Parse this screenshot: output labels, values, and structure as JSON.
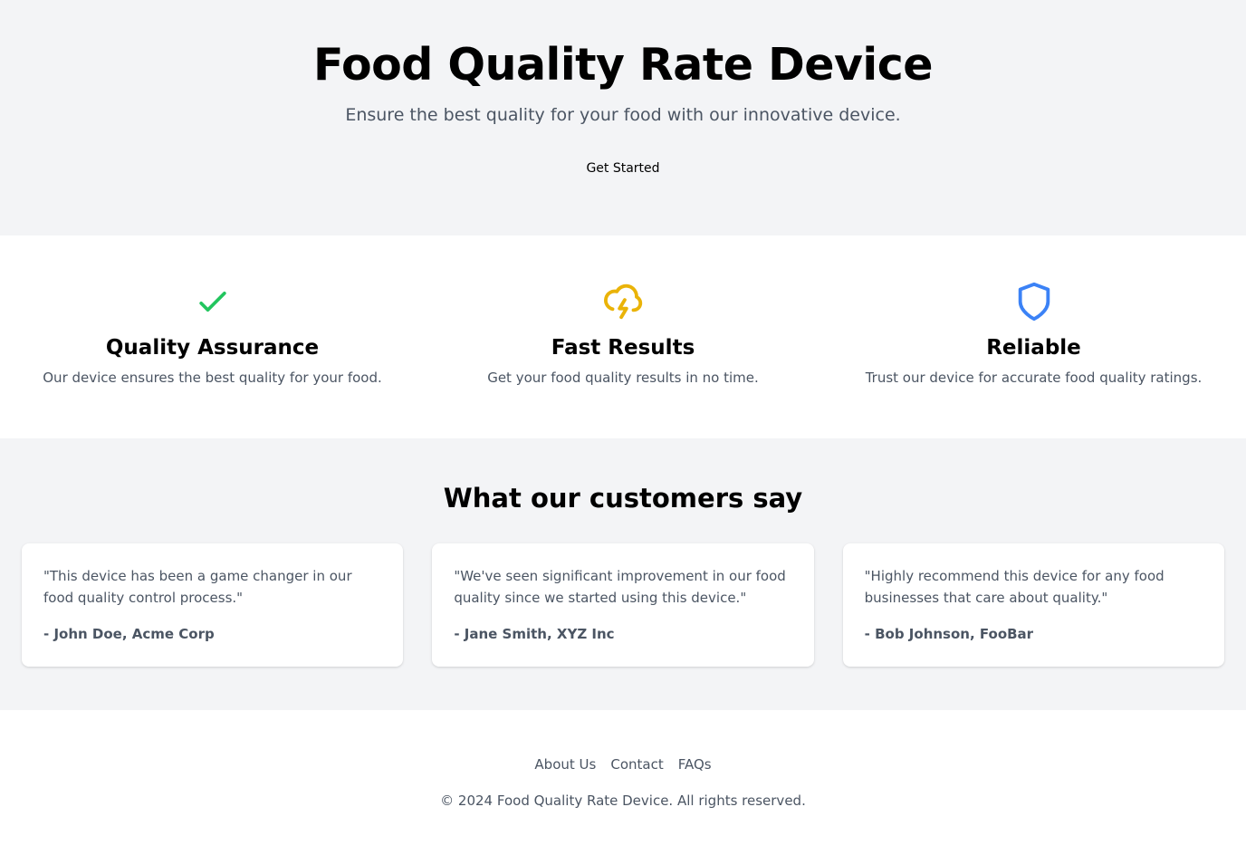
{
  "hero": {
    "title": "Food Quality Rate Device",
    "subtitle": "Ensure the best quality for your food with our innovative device.",
    "cta_label": "Get Started"
  },
  "features": [
    {
      "icon": "check-icon",
      "color": "#22c55e",
      "title": "Quality Assurance",
      "description": "Our device ensures the best quality for your food."
    },
    {
      "icon": "cloud-lightning-icon",
      "color": "#eab308",
      "title": "Fast Results",
      "description": "Get your food quality results in no time."
    },
    {
      "icon": "shield-icon",
      "color": "#3b82f6",
      "title": "Reliable",
      "description": "Trust our device for accurate food quality ratings."
    }
  ],
  "testimonials": {
    "heading": "What our customers say",
    "items": [
      {
        "quote": "\"This device has been a game changer in our food quality control process.\"",
        "author": "- John Doe, Acme Corp"
      },
      {
        "quote": "\"We've seen significant improvement in our food quality since we started using this device.\"",
        "author": "- Jane Smith, XYZ Inc"
      },
      {
        "quote": "\"Highly recommend this device for any food businesses that care about quality.\"",
        "author": "- Bob Johnson, FooBar"
      }
    ]
  },
  "footer": {
    "links": [
      "About Us",
      "Contact",
      "FAQs"
    ],
    "copyright": "© 2024 Food Quality Rate Device. All rights reserved."
  }
}
